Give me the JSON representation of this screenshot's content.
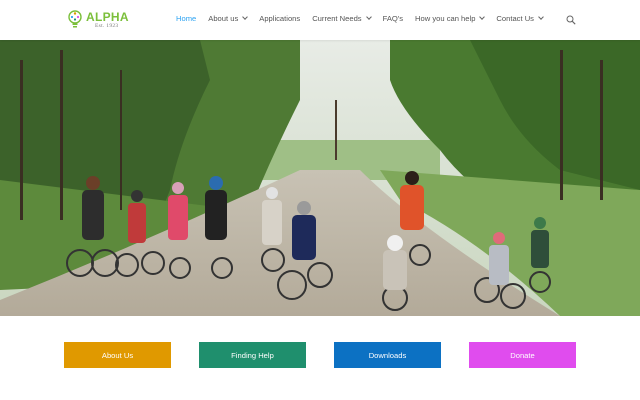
{
  "logo": {
    "name": "ALPHA",
    "est": "Est. 1923"
  },
  "nav": {
    "items": [
      {
        "label": "Home",
        "active": true,
        "has_dropdown": false
      },
      {
        "label": "About us",
        "active": false,
        "has_dropdown": true
      },
      {
        "label": "Applications",
        "active": false,
        "has_dropdown": false
      },
      {
        "label": "Current Needs",
        "active": false,
        "has_dropdown": true
      },
      {
        "label": "FAQ's",
        "active": false,
        "has_dropdown": false
      },
      {
        "label": "How you can help",
        "active": false,
        "has_dropdown": true
      },
      {
        "label": "Contact Us",
        "active": false,
        "has_dropdown": true
      }
    ],
    "active_color": "#2ea3f2",
    "search_icon": "search-icon"
  },
  "hero": {
    "icon": "photo-children-on-bicycles-on-forest-gravel-path"
  },
  "buttons": [
    {
      "label": "About Us",
      "color": "#e09900"
    },
    {
      "label": "Finding Help",
      "color": "#1f8f6d"
    },
    {
      "label": "Downloads",
      "color": "#0c71c3"
    },
    {
      "label": "Donate",
      "color": "#e04cee"
    }
  ]
}
